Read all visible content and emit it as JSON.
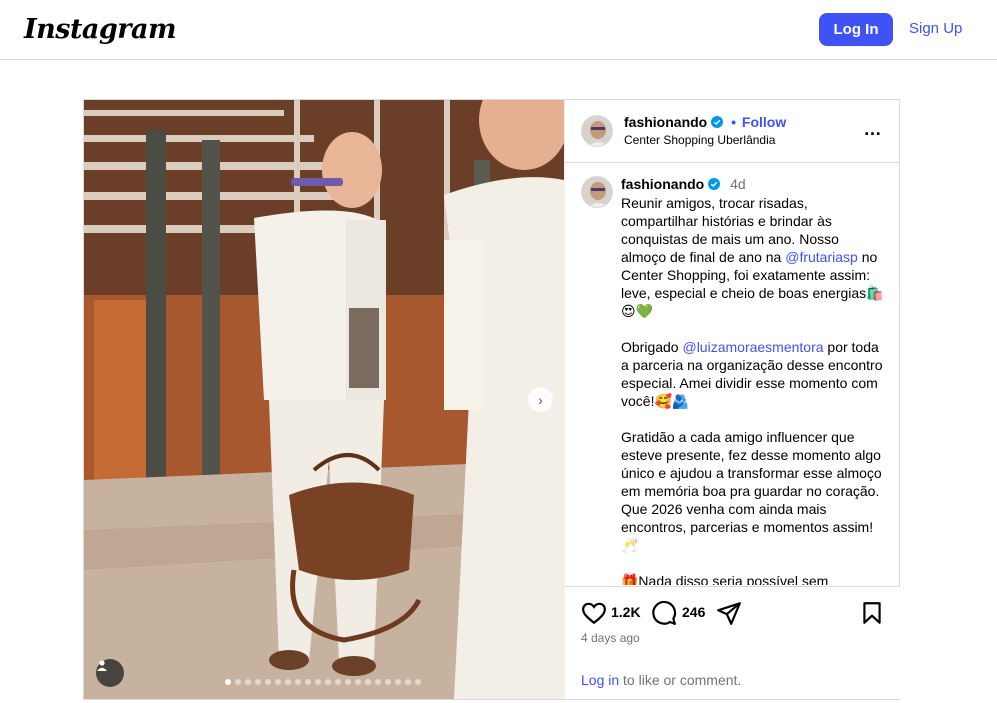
{
  "brand": {
    "logo_text": "Instagram"
  },
  "nav": {
    "login_label": "Log In",
    "signup_label": "Sign Up"
  },
  "post": {
    "username": "fashionando",
    "separator": "•",
    "follow_label": "Follow",
    "location": "Center Shopping Uberlândia",
    "more_icon": "more-options-icon",
    "caption": {
      "username": "fashionando",
      "time_ago": "4d",
      "p1_a": "Reunir amigos, trocar risadas, compartilhar histórias e brindar às conquistas de mais um ano. Nosso almoço de final de ano na ",
      "p1_mention": "@frutariasp",
      "p1_b": "  no Center Shopping, foi exatamente assim: leve, especial e cheio de boas energias🛍️😍💚",
      "p2_a": "Obrigado ",
      "p2_mention": "@luizamoraesmentora",
      "p2_b": " por toda a parceria na organização desse encontro especial. Amei dividir esse momento com você!🥰🫂",
      "p3": "Gratidão a cada amigo influencer que esteve presente, fez desse momento algo único e ajudou a transformar esse almoço em memória boa pra guardar no coração. Que 2026 venha com ainda mais encontros, parcerias e momentos assim! 🥂",
      "p4": "🎁Nada disso seria possível sem parceiros incríveis. Obrigado por confiarem,"
    },
    "likes": "1.2K",
    "comments": "246",
    "posted_ago": "4 days ago",
    "login_prompt_link": "Log in",
    "login_prompt_rest": " to like or comment.",
    "carousel": {
      "total_slides": 20,
      "active_index": 0
    },
    "colors": {
      "accent": "#3f52f6",
      "verified": "#0095f6",
      "muted": "#737373"
    }
  }
}
